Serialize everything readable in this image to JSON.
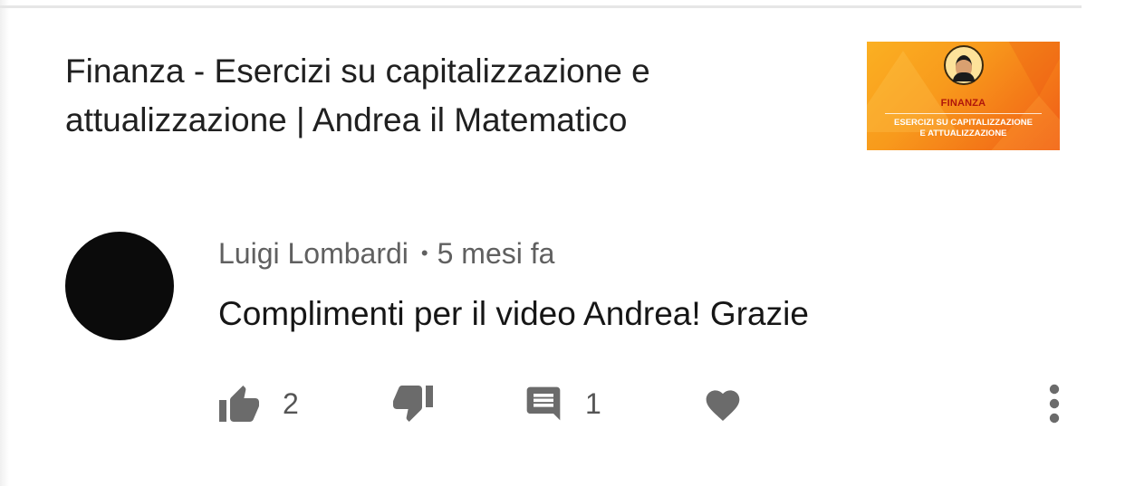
{
  "video": {
    "title": "Finanza - Esercizi su capitalizzazione e\nattualizzazione | Andrea il Matematico",
    "thumbnail": {
      "title": "FINANZA",
      "subtitle": "ESERCIZI SU CAPITALIZZAZIONE\nE ATTUALIZZAZIONE",
      "colors": {
        "start": "#fbb022",
        "end": "#f05a17",
        "title": "#b0160b"
      }
    }
  },
  "comment": {
    "author": "Luigi Lombardi",
    "separator": "•",
    "time": "5 mesi fa",
    "text": "Complimenti per il video Andrea! Grazie",
    "avatar_color": "#0b0b0b"
  },
  "actions": {
    "like": {
      "icon": "thumbs-up-icon",
      "count": "2"
    },
    "dislike": {
      "icon": "thumbs-down-icon"
    },
    "reply": {
      "icon": "comment-icon",
      "count": "1"
    },
    "heart": {
      "icon": "heart-icon"
    },
    "more": {
      "icon": "more-vertical-icon"
    }
  },
  "colors": {
    "icon": "#6b6b6b",
    "text_primary": "#161616",
    "text_secondary": "#606060"
  }
}
